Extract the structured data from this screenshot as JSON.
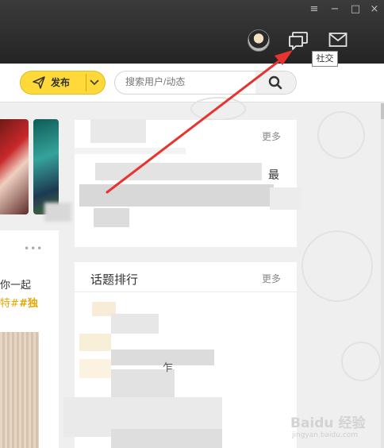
{
  "window": {
    "controls": [
      "≡",
      "−",
      "□",
      "×"
    ]
  },
  "header": {
    "avatar_icon": "user-avatar",
    "social_tooltip": "社交",
    "chat_icon": "chat-bubble-icon",
    "mail_icon": "mail-icon"
  },
  "toolbar": {
    "publish_label": "发布",
    "search_placeholder": "搜索用户/动态"
  },
  "feed": {
    "more_label": "更多",
    "fragment_gt": "最",
    "left_post_text": "你一起",
    "left_post_tag1": "特#",
    "left_post_tag2": "#独"
  },
  "topics": {
    "title": "话题排行",
    "more_label": "更多",
    "fragment": "乍"
  },
  "watermark": {
    "text": "Baidu 经验",
    "sub": "jingyan.baidu.com"
  },
  "colors": {
    "accent": "#ffd93a",
    "titlebar": "#2e2e2e",
    "annotation_arrow": "#e8332f"
  }
}
